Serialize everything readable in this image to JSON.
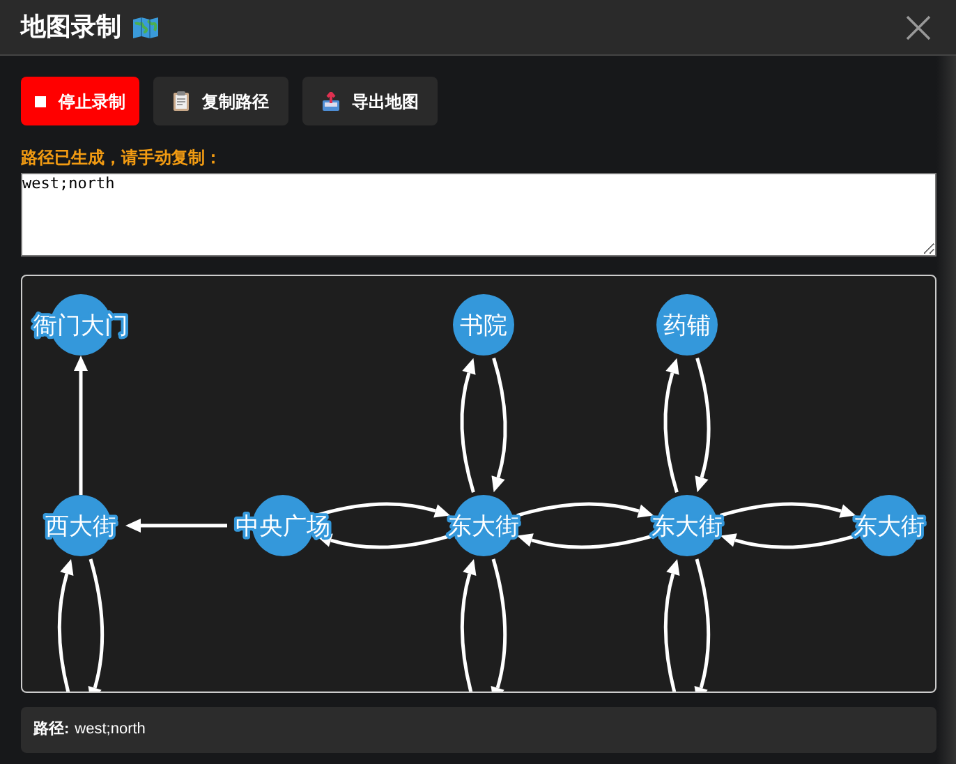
{
  "window": {
    "title": "地图录制"
  },
  "toolbar": [
    {
      "kind": "stop",
      "label": "停止录制"
    },
    {
      "kind": "copy",
      "label": "复制路径"
    },
    {
      "kind": "export",
      "label": "导出地图"
    }
  ],
  "path_output": {
    "label": "路径已生成，请手动复制：",
    "value": "west;north"
  },
  "map": {
    "nodes": [
      {
        "name": "衙门大门"
      },
      {
        "name": "书院"
      },
      {
        "name": "药铺"
      },
      {
        "name": "西大街"
      },
      {
        "name": "中央广场"
      },
      {
        "name": "东大街"
      },
      {
        "name": "东大街"
      },
      {
        "name": "东大街"
      }
    ]
  },
  "status": {
    "label": "路径:",
    "value": "west;north"
  }
}
